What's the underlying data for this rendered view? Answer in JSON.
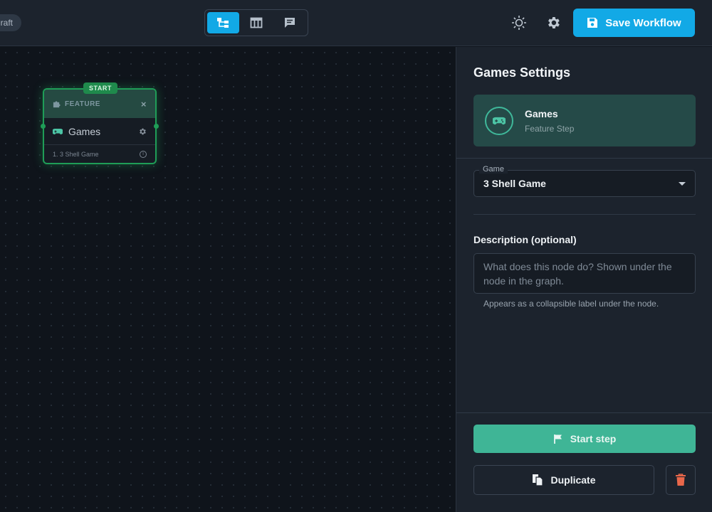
{
  "topbar": {
    "draft_label": "raft",
    "save_label": "Save Workflow",
    "views": [
      {
        "name": "graph-view-icon",
        "active": true
      },
      {
        "name": "table-view-icon",
        "active": false
      },
      {
        "name": "comment-view-icon",
        "active": false
      }
    ]
  },
  "node": {
    "start_badge": "START",
    "type_label": "FEATURE",
    "close": "×",
    "title": "Games",
    "items": [
      "1. 3 Shell Game"
    ]
  },
  "panel": {
    "title": "Games Settings",
    "step": {
      "name": "Games",
      "type": "Feature Step"
    },
    "game_field": {
      "label": "Game",
      "value": "3 Shell Game"
    },
    "description": {
      "label": "Description (optional)",
      "placeholder": "What does this node do? Shown under the node in the graph.",
      "hint": "Appears as a collapsible label under the node."
    },
    "start_step_label": "Start step",
    "duplicate_label": "Duplicate"
  },
  "colors": {
    "accent": "#12a9e6",
    "start_green": "#3fb596",
    "node_border": "#1f9d57",
    "danger": "#e8674a"
  }
}
